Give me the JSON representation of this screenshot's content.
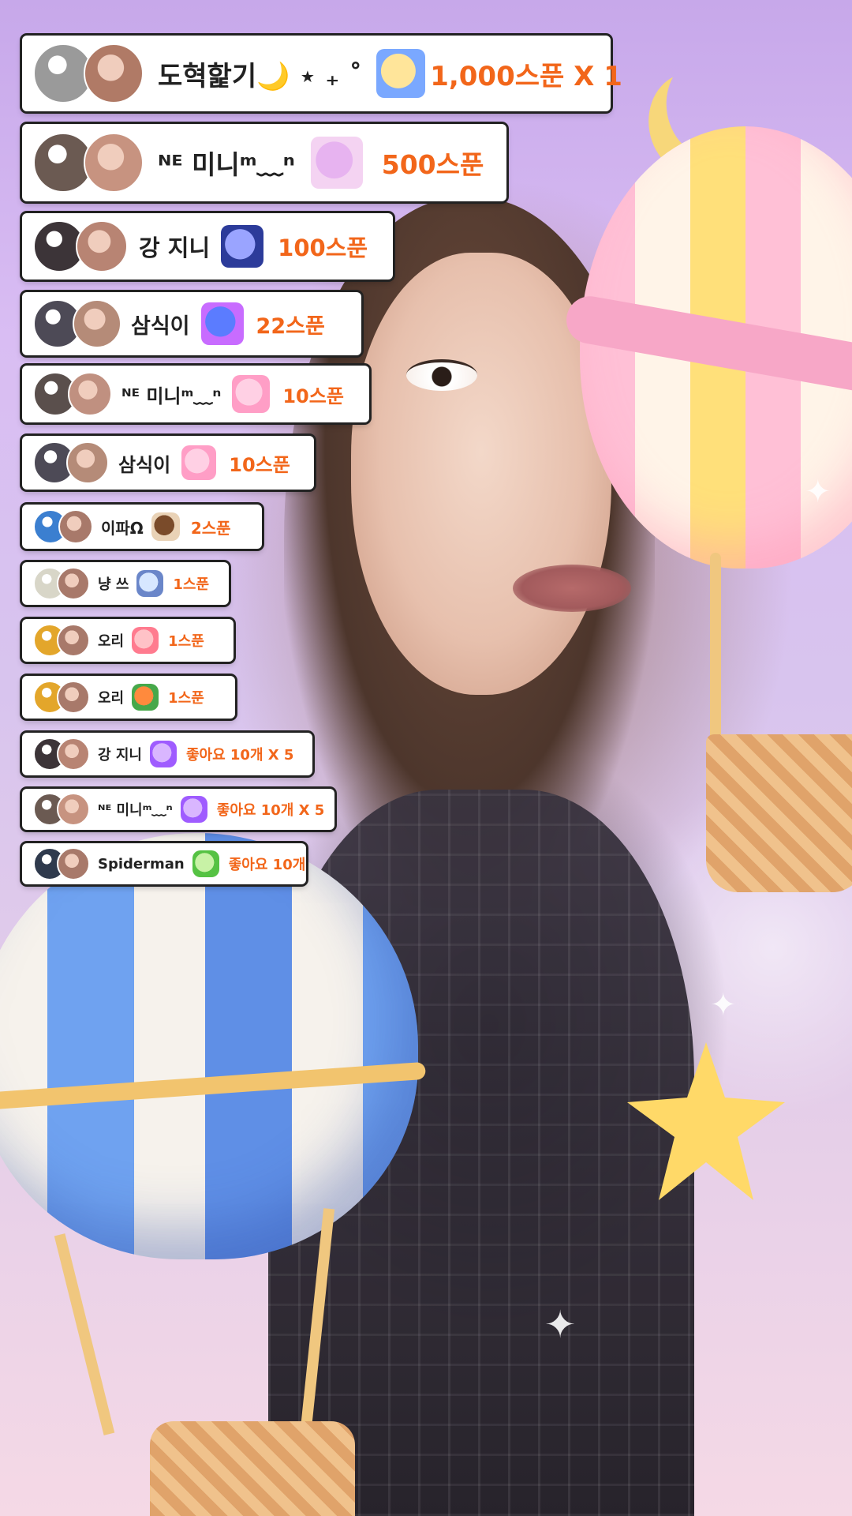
{
  "gifts": [
    {
      "name": "도혁핥기🌙 ⋆ ₊ ˚",
      "icon": "cake-sticker-icon",
      "amount": "1,000스푼 X 1",
      "icon_colors": [
        "#ffe59a",
        "#7aa8ff"
      ]
    },
    {
      "name": "ᴺᴱ 미니ᵐ︎﹏ⁿ",
      "icon": "castle-train-icon",
      "amount": "500스푼",
      "icon_colors": [
        "#e7b3f0",
        "#f4d3f2"
      ]
    },
    {
      "name": "강 지니",
      "icon": "moon-cat-icon",
      "amount": "100스푼",
      "icon_colors": [
        "#9aa4ff",
        "#2c3b9a"
      ]
    },
    {
      "name": "삼식이",
      "icon": "butterfly-icon",
      "amount": "22스푼",
      "icon_colors": [
        "#5b7cff",
        "#c86cff"
      ]
    },
    {
      "name": "ᴺᴱ 미니ᵐ︎﹏ⁿ",
      "icon": "pink-bunny-icon",
      "amount": "10스푼",
      "icon_colors": [
        "#ffd0e4",
        "#ff9ec6"
      ]
    },
    {
      "name": "삼식이",
      "icon": "pink-bunny-icon",
      "amount": "10스푼",
      "icon_colors": [
        "#ffd0e4",
        "#ff9ec6"
      ]
    },
    {
      "name": "이파Ω",
      "icon": "coffee-cup-icon",
      "amount": "2스푼",
      "icon_colors": [
        "#7a4b2a",
        "#e9d2b6"
      ]
    },
    {
      "name": "냥 쓰",
      "icon": "hello-bubble-icon",
      "amount": "1스푼",
      "icon_colors": [
        "#d7e7ff",
        "#6a86c9"
      ]
    },
    {
      "name": "오리",
      "icon": "ice-pop-icon",
      "amount": "1스푼",
      "icon_colors": [
        "#ffc2c7",
        "#ff7b8f"
      ]
    },
    {
      "name": "오리",
      "icon": "carrot-icon",
      "amount": "1스푼",
      "icon_colors": [
        "#ff8a3d",
        "#46a84a"
      ]
    },
    {
      "name": "강 지니",
      "icon": "purple-heart-icon",
      "amount": "좋아요 10개 X 5",
      "icon_colors": [
        "#d9b6ff",
        "#9f5cff"
      ]
    },
    {
      "name": "ᴺᴱ 미니ᵐ︎﹏ⁿ",
      "icon": "purple-heart-icon",
      "amount": "좋아요 10개 X 5",
      "icon_colors": [
        "#d9b6ff",
        "#9f5cff"
      ]
    },
    {
      "name": "Spiderman",
      "icon": "green-heart-icon",
      "amount": "좋아요 10개",
      "icon_colors": [
        "#c8f2a6",
        "#55c243"
      ]
    }
  ],
  "avatar_colors": [
    [
      "#9a9a9a",
      "#b07a66"
    ],
    [
      "#6b5a52",
      "#c79380"
    ],
    [
      "#3c3438",
      "#b88473"
    ],
    [
      "#4d4a56",
      "#b58b78"
    ],
    [
      "#5a4f4c",
      "#c09080"
    ],
    [
      "#4d4a56",
      "#b58b78"
    ],
    [
      "#3b7fd0",
      "#a8796a"
    ],
    [
      "#d8d6c8",
      "#a8796a"
    ],
    [
      "#e3a62b",
      "#a8796a"
    ],
    [
      "#e3a62b",
      "#a8796a"
    ],
    [
      "#3c3438",
      "#b88473"
    ],
    [
      "#6b5a52",
      "#c79380"
    ],
    [
      "#2f3a4d",
      "#a8796a"
    ]
  ]
}
